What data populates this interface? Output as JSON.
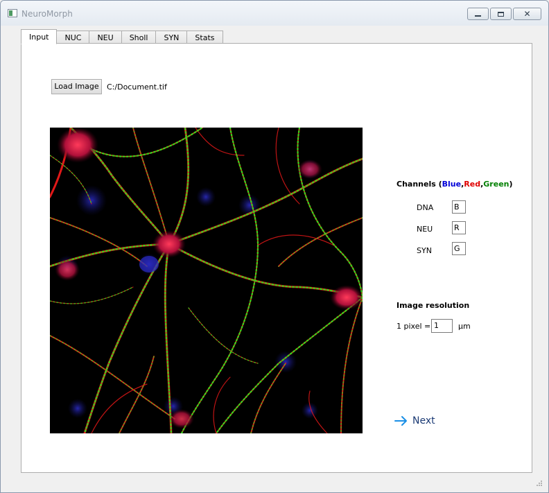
{
  "window": {
    "title": "NeuroMorph"
  },
  "tabs": [
    {
      "label": "Input",
      "active": true
    },
    {
      "label": "NUC",
      "active": false
    },
    {
      "label": "NEU",
      "active": false
    },
    {
      "label": "Sholl",
      "active": false
    },
    {
      "label": "SYN",
      "active": false
    },
    {
      "label": "Stats",
      "active": false
    }
  ],
  "input": {
    "load_button": "Load Image",
    "file_path": "C:/Document.tif"
  },
  "channels": {
    "title": "Channels",
    "legend_blue": "Blue",
    "legend_red": "Red",
    "legend_green": "Green",
    "rows": [
      {
        "label": "DNA",
        "value": "B"
      },
      {
        "label": "NEU",
        "value": "R"
      },
      {
        "label": "SYN",
        "value": "G"
      }
    ]
  },
  "resolution": {
    "title": "Image resolution",
    "label": "1 pixel =",
    "value": "1",
    "unit": "µm"
  },
  "next": {
    "label": "Next"
  },
  "colors": {
    "blue": "#0000d8",
    "red": "#e00000",
    "green": "#008000",
    "accent": "#1a8fe6"
  }
}
